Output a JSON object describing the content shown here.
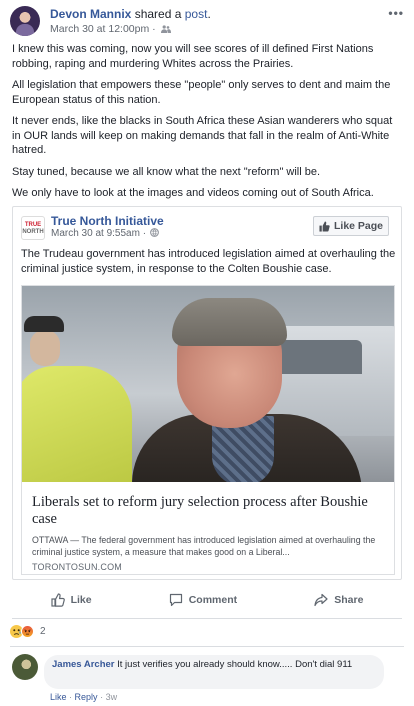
{
  "post": {
    "author": "Devon Mannix",
    "verb_prefix": "shared a",
    "verb_link": "post",
    "verb_suffix": ".",
    "timestamp": "March 30 at 12:00pm ·",
    "paragraphs": [
      "I knew this was coming, now you will see scores of ill defined First Nations robbing, raping and murdering Whites across the Prairies.",
      "All legislation that empowers these \"people\" only serves to dent and maim the European status of this nation.",
      "It never ends, like the blacks in South Africa these Asian wanderers who squat in OUR lands will keep on making demands that fall in the realm of Anti-White hatred.",
      "Stay tuned, because we all know what the next \"reform\" will be.",
      "We only have to look at the images and videos coming out of South Africa."
    ]
  },
  "shared": {
    "page_name": "True North Initiative",
    "page_logo_line1": "TRUE",
    "page_logo_line2": "NORTH",
    "timestamp": "March 30 at 9:55am ·",
    "like_page_label": "Like Page",
    "text": "The Trudeau government has introduced legislation aimed at overhauling the criminal justice system, in response to the Colten Boushie case.",
    "link": {
      "title": "Liberals set to reform jury selection process after Boushie case",
      "description": "OTTAWA — The federal government has introduced legislation aimed at overhauling the criminal justice system, a measure that makes good on a Liberal...",
      "domain": "TORONTOSUN.COM"
    }
  },
  "actions": {
    "like": "Like",
    "comment": "Comment",
    "share": "Share"
  },
  "reactions": {
    "count": "2"
  },
  "comment": {
    "author": "James Archer",
    "text": "It just verifies you already should know..... Don't dial 911",
    "like": "Like",
    "reply": "Reply",
    "time": "3w"
  },
  "colors": {
    "link_blue": "#365899",
    "meta_grey": "#616770"
  }
}
